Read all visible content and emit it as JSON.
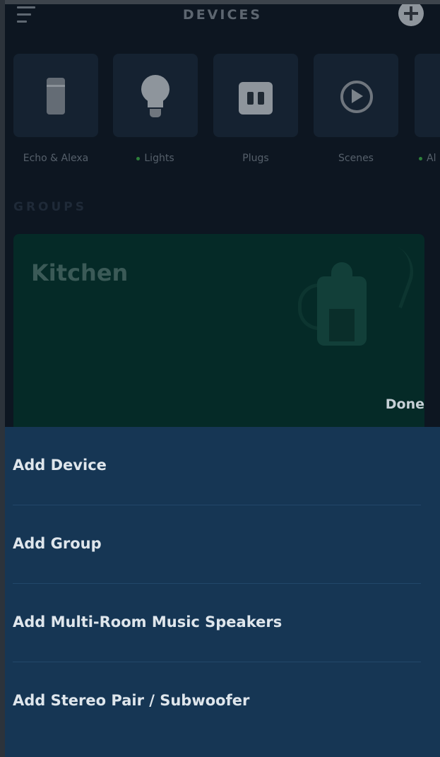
{
  "header": {
    "title": "DEVICES"
  },
  "categories": [
    {
      "label": "Echo & Alexa",
      "icon": "echo-speaker-icon",
      "status_dot": false
    },
    {
      "label": "Lights",
      "icon": "light-bulb-icon",
      "status_dot": true
    },
    {
      "label": "Plugs",
      "icon": "smart-plug-icon",
      "status_dot": false
    },
    {
      "label": "Scenes",
      "icon": "scene-play-icon",
      "status_dot": false
    },
    {
      "label": "Al",
      "icon": "all-devices-icon",
      "status_dot": true
    }
  ],
  "groups": {
    "heading": "GROUPS",
    "items": [
      {
        "name": "Kitchen",
        "action": "Done"
      }
    ]
  },
  "action_sheet": {
    "items": [
      {
        "label": "Add Device"
      },
      {
        "label": "Add Group"
      },
      {
        "label": "Add Multi-Room Music Speakers"
      },
      {
        "label": "Add Stereo Pair / Subwoofer"
      }
    ]
  },
  "colors": {
    "background": "#0d1621",
    "tile": "#152231",
    "group_card": "#052a27",
    "sheet": "#163654",
    "status_dot": "#2d7f3a"
  }
}
